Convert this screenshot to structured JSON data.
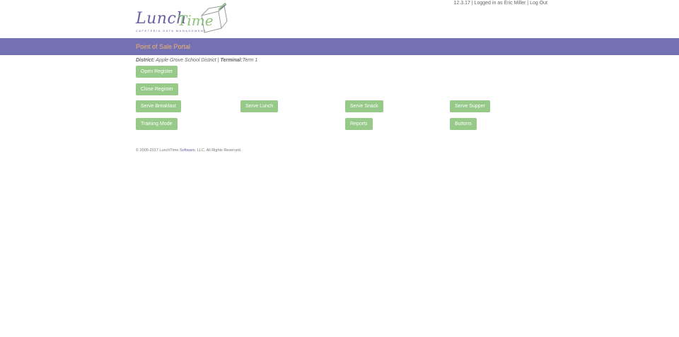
{
  "header": {
    "version": "12.3.17",
    "sep1": " | ",
    "logged_in_text": "Logged in as Eric Miller",
    "sep2": " | ",
    "logout_label": "Log Out"
  },
  "logo": {
    "word1": "Lunch",
    "word2": "Time",
    "tagline": "CAFETERIA DATA MANAGEMENT"
  },
  "banner": {
    "title": "Point of Sale Portal"
  },
  "info": {
    "district_label": "District:",
    "district_value": "Apple Grove School District",
    "separator": " | ",
    "terminal_label": "Terminal:",
    "terminal_value": "Term 1"
  },
  "buttons": {
    "open_register": "Open Register",
    "close_register": "Close Register",
    "serve_breakfast": "Serve Breakfast",
    "serve_lunch": "Serve Lunch",
    "serve_snack": "Serve Snack",
    "serve_supper": "Serve Supper",
    "training_mode": "Training Mode",
    "reports": "Reports",
    "buttons": "Buttons"
  },
  "footer": {
    "prefix": "© 2005-2017 LunchTime",
    "brand": "Software",
    "suffix": ", LLC. All Rights Reserved."
  },
  "colors": {
    "banner": "#7470b4",
    "banner_text": "#f0b36a",
    "button_green": "#97c989",
    "logo_purple": "#6a5fa0",
    "logo_green": "#8dc27b"
  }
}
